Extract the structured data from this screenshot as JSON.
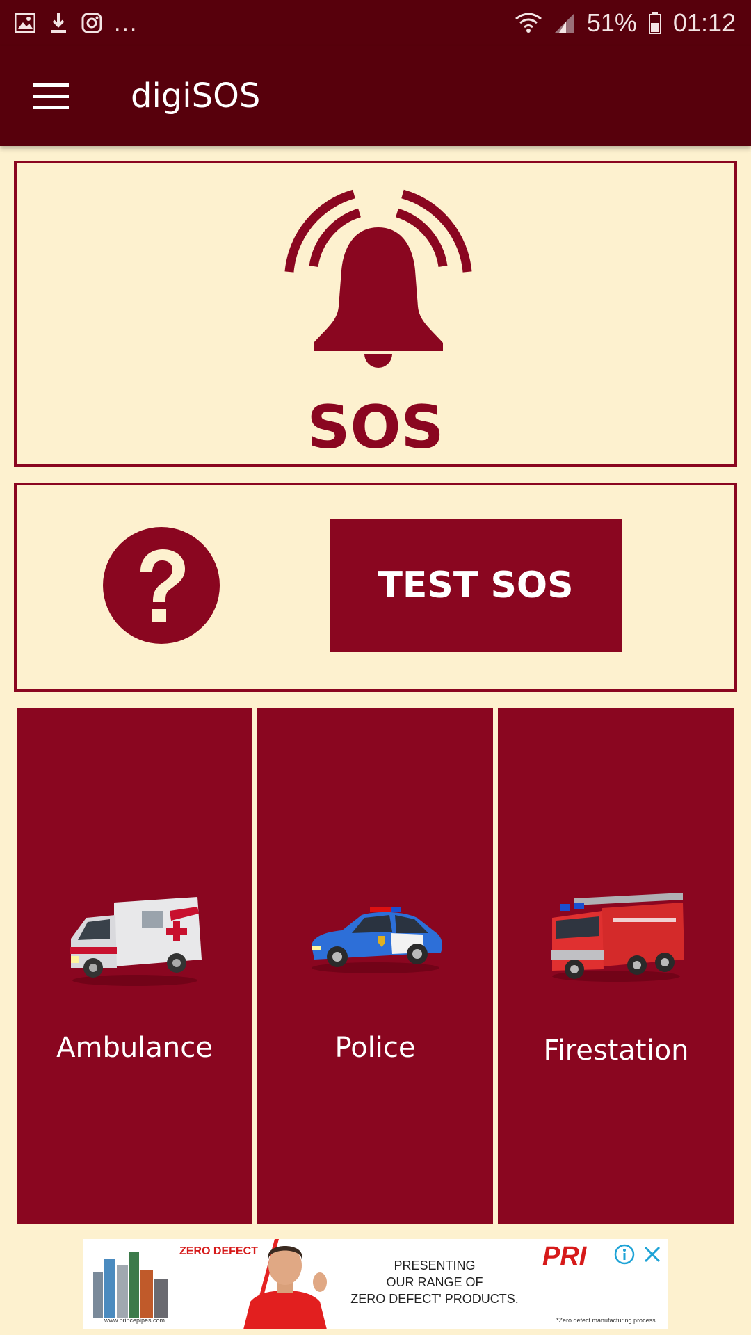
{
  "status_bar": {
    "more": "...",
    "battery": "51%",
    "time": "01:12",
    "icons": [
      "image-icon",
      "download-icon",
      "instagram-icon",
      "wifi-icon",
      "signal-icon",
      "battery-icon"
    ]
  },
  "app_bar": {
    "title": "digiSOS",
    "menu_icon": "menu-icon"
  },
  "sos_panel": {
    "label": "SOS",
    "icon": "alarm-bell-icon"
  },
  "test_panel": {
    "help_icon": "help-icon",
    "button_label": "TEST SOS"
  },
  "services": [
    {
      "label": "Ambulance",
      "icon": "ambulance-icon"
    },
    {
      "label": "Police",
      "icon": "police-car-icon"
    },
    {
      "label": "Firestation",
      "icon": "fire-truck-icon"
    }
  ],
  "ad": {
    "logo": "PRI",
    "text_lines": [
      "PRESENTING",
      "OUR RANGE OF",
      "ZERO DEFECT' PRODUCTS."
    ],
    "brand": "ZERO DEFECT",
    "url": "www.princepipes.com",
    "disclaimer": "*Zero defect manufacturing process"
  },
  "colors": {
    "primary_dark": "#57000c",
    "accent": "#8a0620",
    "background": "#fdf1cf",
    "on_primary": "#ffffff"
  }
}
